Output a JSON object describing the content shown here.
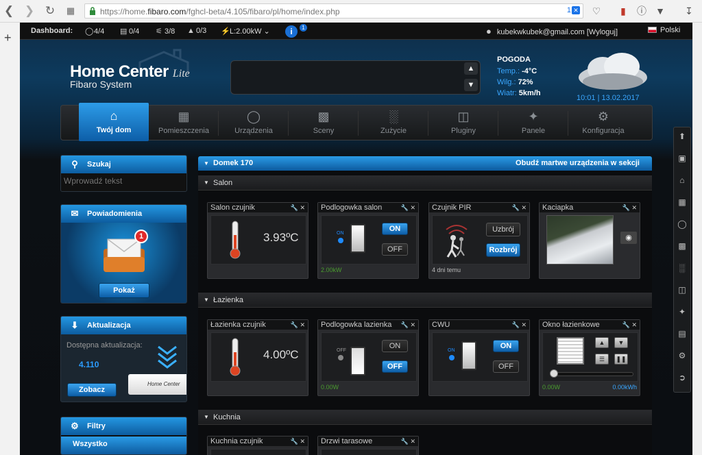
{
  "browser": {
    "url_prefix": "https://home.",
    "url_domain": "fibaro.com",
    "url_rest": "/fghcl-beta/4.105/fibaro/pl/home/index.php",
    "badge": "1"
  },
  "topbar": {
    "label": "Dashboard:",
    "lights": "4/4",
    "doors": "0/4",
    "plugs": "3/8",
    "blinds": "0/3",
    "power": "L:2.00kW",
    "info": "i",
    "info_count": "1",
    "user": "kubekwkubek@gmail.com [Wyloguj]",
    "language": "Polski"
  },
  "logo": {
    "title": "Home Center",
    "edition": "Lite",
    "subtitle": "Fibaro System"
  },
  "weather": {
    "heading": "POGODA",
    "temp_label": "Temp.:",
    "temp": "-4°C",
    "humid_label": "Wilg.:",
    "humid": "72%",
    "wind_label": "Wiatr:",
    "wind": "5km/h",
    "time": "10:01",
    "date": "13.02.2017"
  },
  "nav": [
    {
      "label": "Twój dom",
      "icon": "home-icon"
    },
    {
      "label": "Pomieszczenia",
      "icon": "rooms-icon"
    },
    {
      "label": "Urządzenia",
      "icon": "bulb-icon"
    },
    {
      "label": "Sceny",
      "icon": "clapper-icon"
    },
    {
      "label": "Zużycie",
      "icon": "chart-icon"
    },
    {
      "label": "Pluginy",
      "icon": "box-icon"
    },
    {
      "label": "Panele",
      "icon": "puzzle-icon"
    },
    {
      "label": "Konfiguracja",
      "icon": "gears-icon"
    }
  ],
  "search": {
    "title": "Szukaj",
    "placeholder": "Wprowadź tekst"
  },
  "notifications": {
    "title": "Powiadomienia",
    "count": "1",
    "button": "Pokaż"
  },
  "update": {
    "title": "Aktualizacja",
    "available_label": "Dostępna aktualizacja:",
    "version": "4.110",
    "button": "Zobacz",
    "device_label": "Home Center"
  },
  "filters": {
    "title": "Filtry",
    "item": "Wszystko"
  },
  "section_main": {
    "title": "Domek 170",
    "action": "Obudź martwe urządzenia w sekcji"
  },
  "rooms": [
    {
      "name": "Salon"
    },
    {
      "name": "Łazienka"
    },
    {
      "name": "Kuchnia"
    }
  ],
  "cards": {
    "salon_sensor": {
      "title": "Salon czujnik",
      "value": "3.93ºC"
    },
    "salon_floor": {
      "title": "Podlogowka salon",
      "on": "ON",
      "off": "OFF",
      "led": "ON",
      "power": "2.00kW"
    },
    "pir": {
      "title": "Czujnik PIR",
      "arm": "Uzbrój",
      "disarm": "Rozbrój",
      "last": "4 dni temu"
    },
    "camera": {
      "title": "Kaciapka"
    },
    "bath_sensor": {
      "title": "Łazienka czujnik",
      "value": "4.00ºC"
    },
    "bath_floor": {
      "title": "Podlogowka lazienka",
      "on": "ON",
      "off": "OFF",
      "led": "OFF",
      "power": "0.00W"
    },
    "cwu": {
      "title": "CWU",
      "on": "ON",
      "off": "OFF",
      "led": "ON"
    },
    "window": {
      "title": "Okno łazienkowe",
      "power": "0.00W",
      "energy": "0.00kWh"
    },
    "kitchen_sensor": {
      "title": "Kuchnia czujnik"
    },
    "terrace": {
      "title": "Drzwi tarasowe"
    }
  },
  "colors": {
    "accent": "#1a8fe0",
    "bg": "#0b0e12",
    "green": "#4a9d2f"
  }
}
